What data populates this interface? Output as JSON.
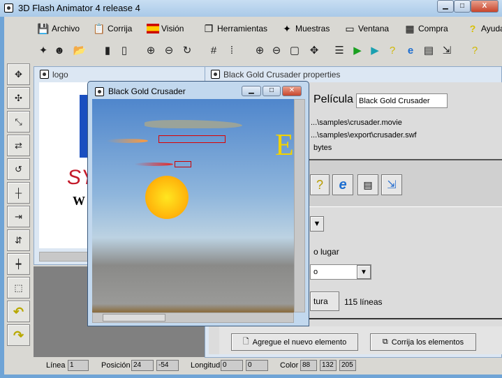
{
  "window": {
    "title": "3D Flash Animator 4 release 4",
    "controls": [
      "minimize",
      "maximize",
      "close"
    ]
  },
  "menu": [
    {
      "label": "Archivo",
      "icon": "floppy-disk-icon"
    },
    {
      "label": "Corrija",
      "icon": "clipboard-icon"
    },
    {
      "label": "Visión",
      "icon": "spain-flag-icon"
    },
    {
      "label": "Herramientas",
      "icon": "windows-stack-icon"
    },
    {
      "label": "Muestras",
      "icon": "samples-icon"
    },
    {
      "label": "Ventana",
      "icon": "window-tile-icon"
    },
    {
      "label": "Compra",
      "icon": "buy-icon"
    },
    {
      "label": "Ayuda",
      "icon": "help-icon"
    }
  ],
  "toolbar": [
    "samples-icon",
    "mona-lisa-icon",
    "open-folder-icon",
    "save-icon",
    "save-all-icon",
    "rotate-x-icon",
    "rotate-y-icon",
    "rotate-z-icon",
    "grid-icon",
    "points-grid-icon",
    "zoom-in-icon",
    "zoom-out-icon",
    "zoom-fit-icon",
    "pan-icon",
    "list-icon",
    "play-icon",
    "play-alt-icon",
    "help-context-icon",
    "internet-explorer-icon",
    "properties-icon",
    "export-icon",
    "help-icon"
  ],
  "tools": [
    "move-icon",
    "move-points-icon",
    "scale-icon",
    "move-horizontal-icon",
    "rotate-icon",
    "grid-snap-icon",
    "align-horizontal-icon",
    "align-vertical-icon",
    "center-icon",
    "select-rect-icon",
    "undo-icon",
    "redo-icon"
  ],
  "logo_window": {
    "title": "logo"
  },
  "movie_window": {
    "title": "Black Gold Crusader"
  },
  "properties": {
    "title": "Black Gold Crusader properties",
    "movie_label": "Película",
    "movie_name": "Black Gold Crusader",
    "movie_path": "...\\samples\\crusader.movie",
    "export_path": "...\\samples\\export\\crusader.swf",
    "size_text": "bytes",
    "place_label": "o lugar",
    "combo_value": "o",
    "script_button": "tura",
    "line_count": "115 líneas",
    "add_button": "Agregue el nuevo elemento",
    "edit_button": "Corrija los elementos"
  },
  "status": {
    "line_label": "Línea",
    "line": "1",
    "position_label": "Posición",
    "pos_x": "24",
    "pos_y": "-54",
    "length_label": "Longitud",
    "len_x": "0",
    "len_y": "0",
    "color_label": "Color",
    "r": "88",
    "g": "132",
    "b": "205"
  }
}
